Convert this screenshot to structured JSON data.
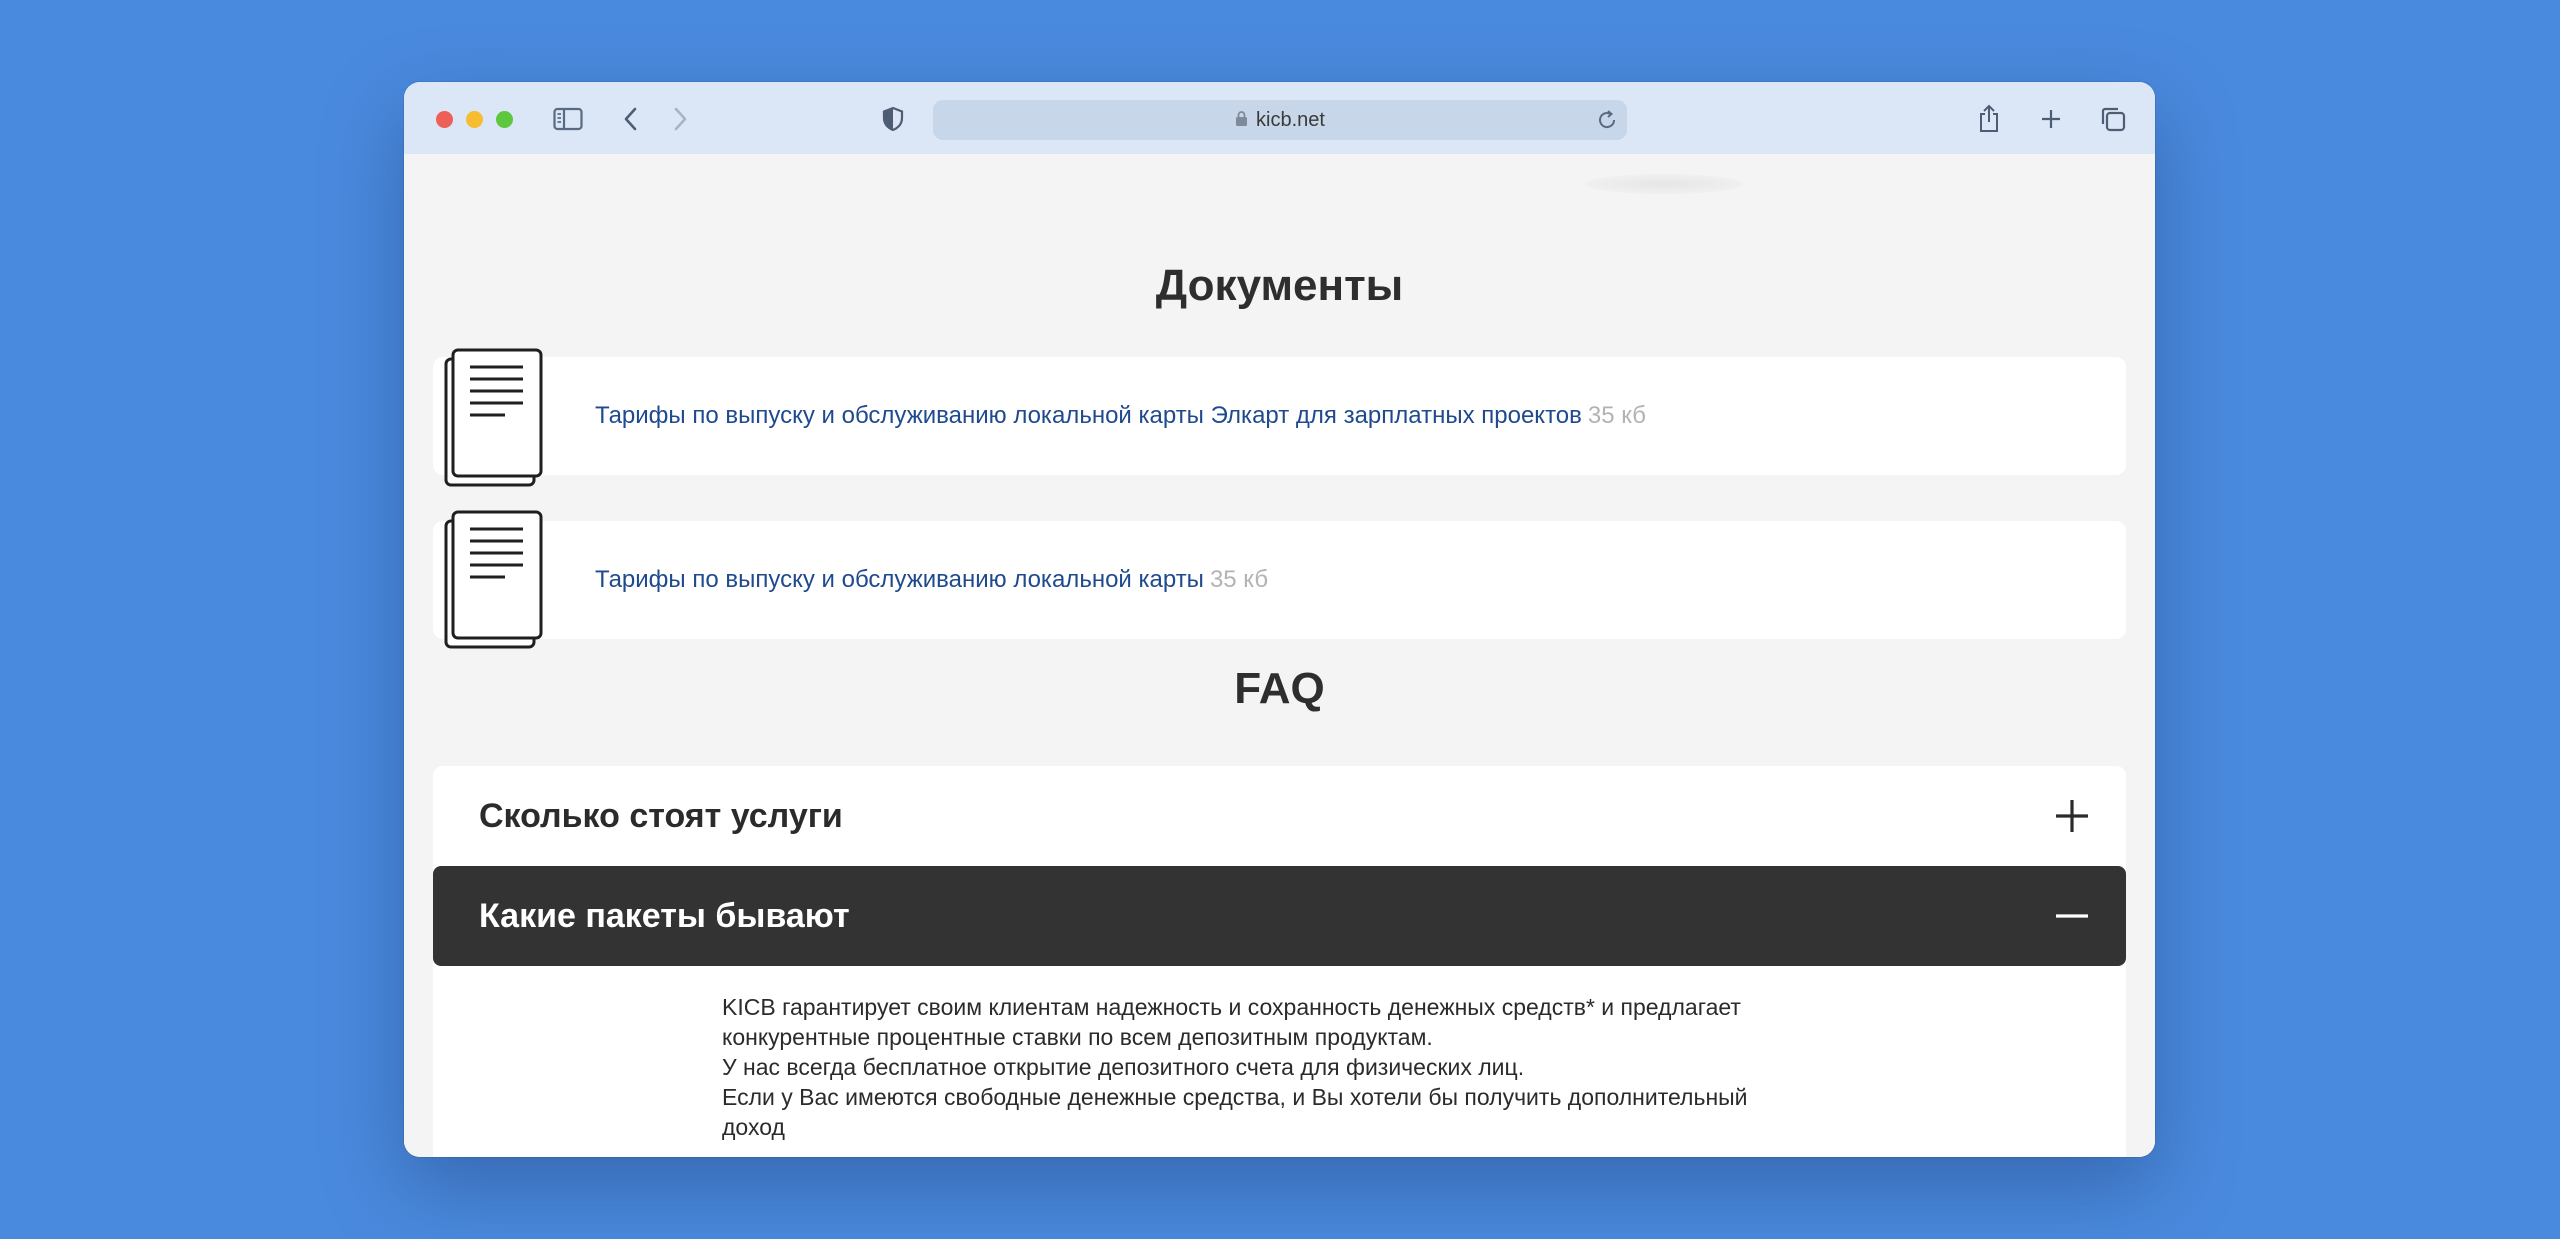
{
  "browser": {
    "url": "kicb.net"
  },
  "documents": {
    "title": "Документы",
    "items": [
      {
        "label": "Тарифы по выпуску и обслуживанию локальной карты Элкарт для зарплатных проектов",
        "size": "35 кб"
      },
      {
        "label": "Тарифы по выпуску и обслуживанию локальной карты",
        "size": "35 кб"
      }
    ]
  },
  "faq": {
    "title": "FAQ",
    "items": [
      {
        "question": "Сколько стоят услуги",
        "expanded": false
      },
      {
        "question": "Какие пакеты бывают",
        "expanded": true
      }
    ],
    "answer_lines": [
      "KICB гарантирует своим клиентам надежность и сохранность денежных средств* и предлагает",
      "конкурентные процентные ставки по всем депозитным продуктам.",
      "У нас всегда бесплатное открытие депозитного счета для физических лиц.",
      "Если у Вас имеются свободные денежные средства, и Вы хотели бы получить дополнительный",
      "доход"
    ]
  },
  "icons": {
    "sidebar": "sidebar-icon",
    "back": "chevron-left-icon",
    "forward": "chevron-right-icon",
    "privacy": "shield-icon",
    "lock": "lock-icon",
    "reload": "reload-icon",
    "share": "share-icon",
    "new_tab": "plus-icon",
    "tabs": "tabs-icon",
    "document": "document-icon",
    "expand": "plus-icon",
    "collapse": "minus-icon"
  },
  "colors": {
    "background": "#4a8ade",
    "titlebar": "#dbe7f7",
    "link": "#1f4a8e",
    "size_text": "#b3b3b3",
    "active_faq": "#333333"
  }
}
